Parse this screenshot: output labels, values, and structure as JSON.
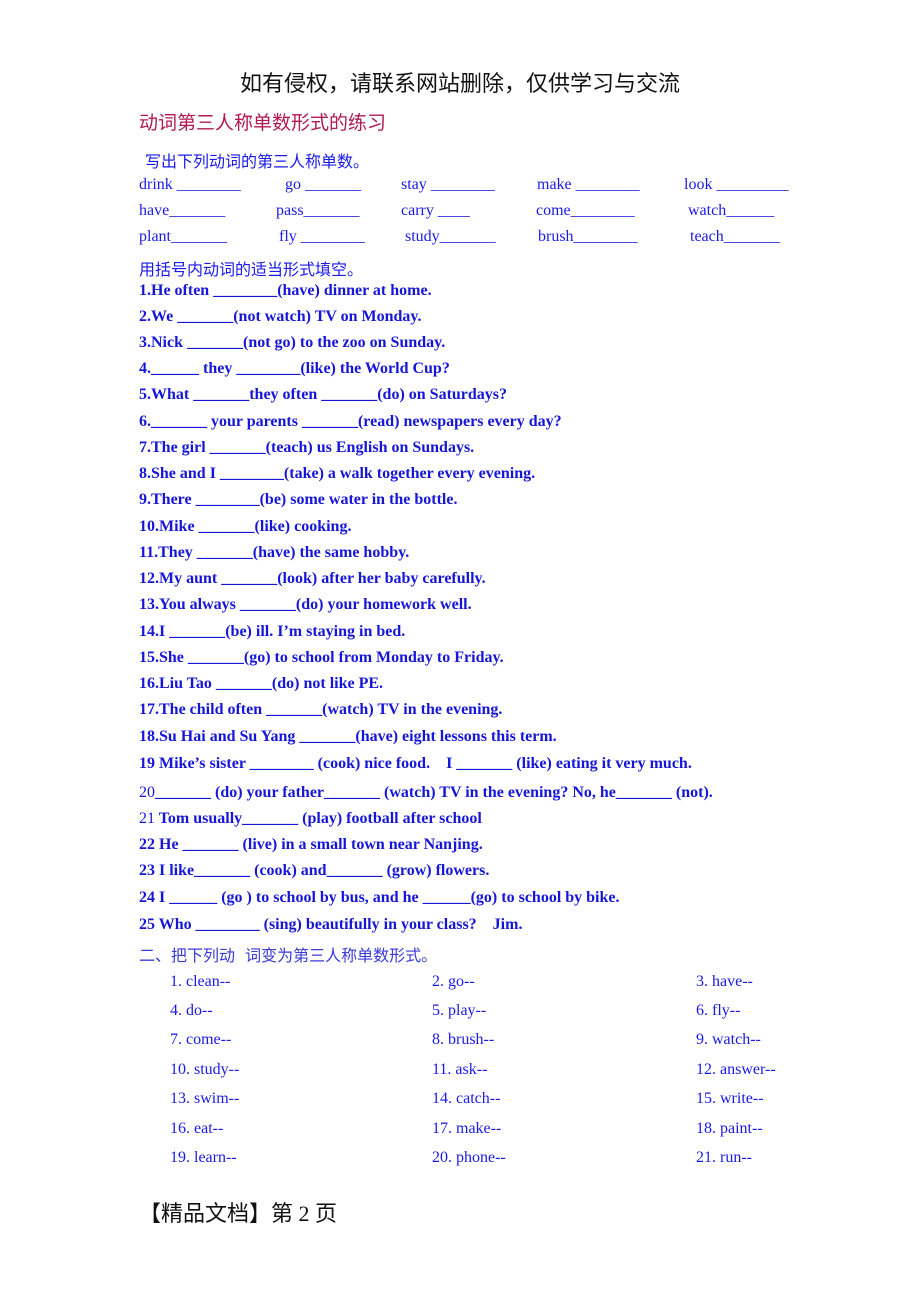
{
  "header_note": "如有侵权，请联系网站删除，仅供学习与交流",
  "title": "动词第三人称单数形式的练习",
  "part1": {
    "instruction": "写出下列动词的第三人称单数。",
    "rows": [
      [
        "drink ________",
        "go _______",
        "stay ________",
        "make ________",
        "look _________"
      ],
      [
        "have_______",
        "pass_______",
        "carry ____",
        "come________",
        "watch______"
      ],
      [
        "plant_______",
        "fly ________",
        "study_______",
        "brush________",
        "teach_______"
      ]
    ]
  },
  "part2": {
    "instruction": "用括号内动词的适当形式填空。",
    "questions": [
      "1.He often ________(have) dinner at home.",
      "2.We _______(not watch) TV on Monday.",
      "3.Nick _______(not go) to the zoo on Sunday.",
      "4.______ they ________(like) the World Cup?",
      "5.What _______they often _______(do) on Saturdays?",
      "6._______ your parents _______(read) newspapers every day?",
      "7.The girl _______(teach) us English on Sundays.",
      "8.She and I ________(take) a walk together every evening.",
      "9.There ________(be) some water in the bottle.",
      "10.Mike _______(like) cooking.",
      "11.They _______(have) the same hobby.",
      "12.My aunt _______(look) after her baby carefully.",
      "13.You always _______(do) your homework well.",
      "14.I _______(be) ill. I’m staying in bed.",
      "15.She _______(go) to school from Monday to Friday.",
      "16.Liu Tao _______(do) not like PE.",
      "17.The child often _______(watch) TV in the evening.",
      "18.Su Hai and Su Yang _______(have) eight lessons this term.",
      "19 Mike’s sister ________ (cook) nice food.    I _______ (like) eating it very much.",
      "20_______ (do) your father_______ (watch) TV in the evening? No, he_______ (not).",
      "Tom usually_______ (play) football after school",
      "22 He _______ (live) in a small town near Nanjing.",
      "23 I like_______ (cook) and_______ (grow) flowers.",
      "24 I ______ (go ) to school by bus, and he ______(go) to school by bike.",
      "25 Who ________ (sing) beautifully in your class?    Jim."
    ],
    "q21_number": "21"
  },
  "part3": {
    "instruction": "二、把下列动  词变为第三人称单数形式。",
    "items": [
      "1. clean--",
      "2. go--",
      "3. have--",
      "4. do--",
      "5. play--",
      "6. fly--",
      "7. come--",
      "8. brush--",
      "9. watch--",
      "10. study--",
      "11. ask--",
      "12. answer--",
      "13. swim--",
      "14. catch--",
      "15. write--",
      "16. eat--",
      "17. make--",
      "18. paint--",
      "19. learn--",
      "20. phone--",
      "21. run--"
    ]
  },
  "footer": "【精品文档】第 2 页"
}
